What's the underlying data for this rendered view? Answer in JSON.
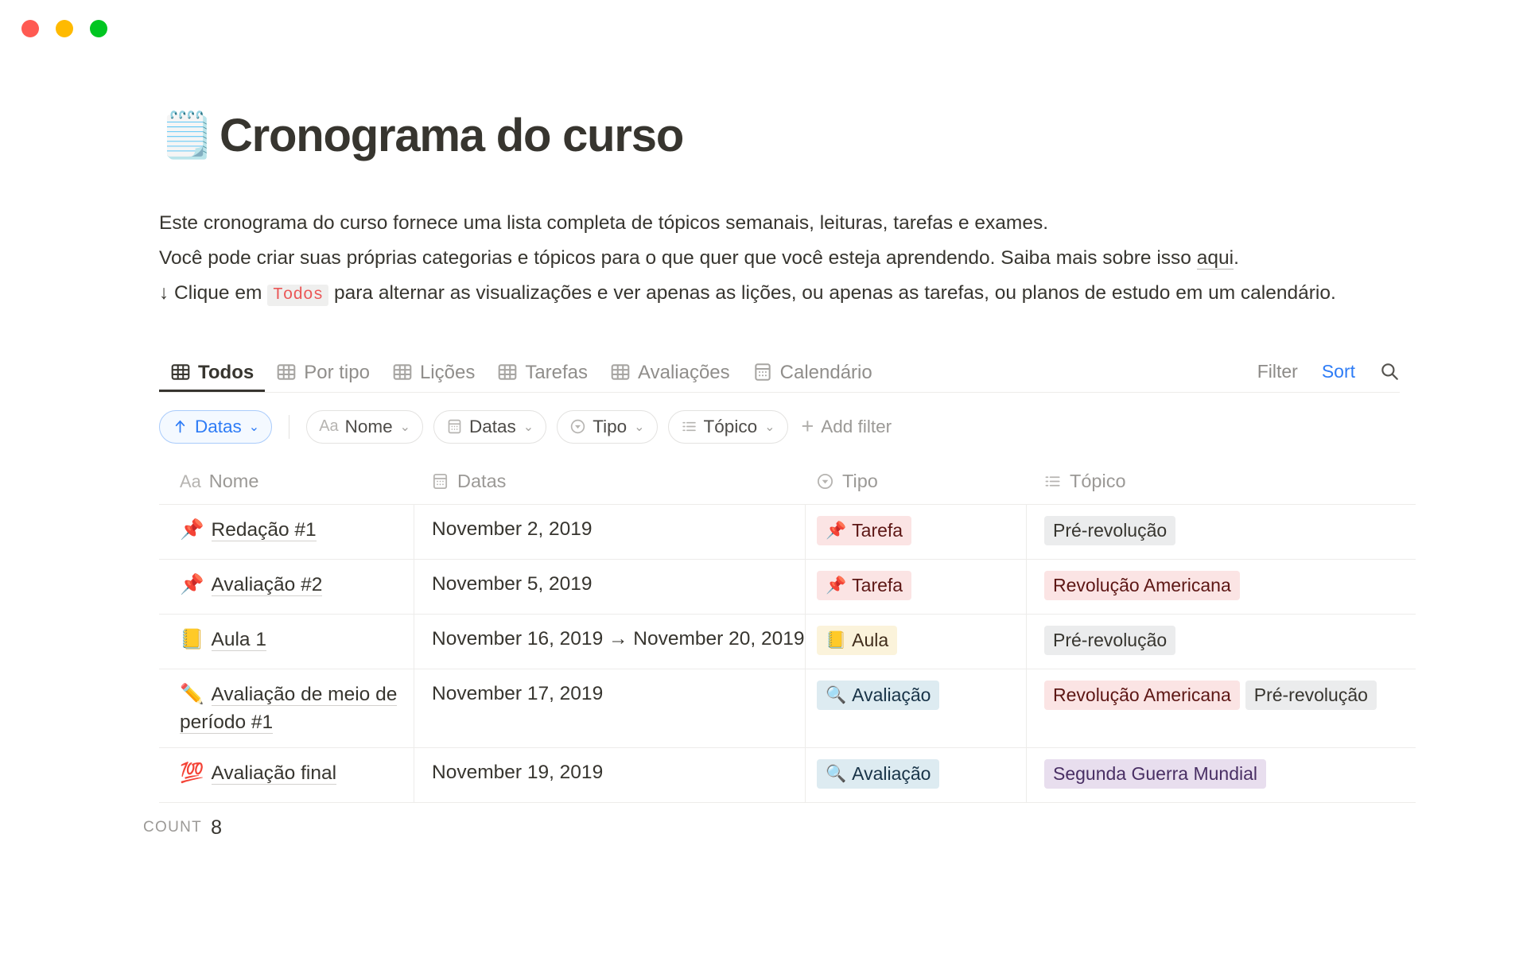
{
  "window": {
    "traffic_lights": [
      {
        "name": "close",
        "color": "#FF5A52"
      },
      {
        "name": "minimize",
        "color": "#FFBA00"
      },
      {
        "name": "maximize",
        "color": "#00C621"
      }
    ]
  },
  "page": {
    "emoji": "🗒️",
    "title": "Cronograma do curso",
    "description": {
      "line1": "Este cronograma do curso fornece uma lista completa de tópicos semanais, leituras, tarefas e exames.",
      "line2_a": "Você pode criar suas próprias categorias e tópicos para o que quer que você esteja aprendendo. Saiba mais sobre isso ",
      "line2_link": "aqui",
      "line2_b": ".",
      "line3_a": "↓ Clique em ",
      "line3_code": "Todos",
      "line3_b": " para alternar as visualizações e ver apenas as lições, ou apenas as tarefas, ou planos de estudo em um calendário."
    }
  },
  "tabs": [
    {
      "label": "Todos",
      "icon": "table-icon",
      "active": true
    },
    {
      "label": "Por tipo",
      "icon": "table-icon",
      "active": false
    },
    {
      "label": "Lições",
      "icon": "table-icon",
      "active": false
    },
    {
      "label": "Tarefas",
      "icon": "table-icon",
      "active": false
    },
    {
      "label": "Avaliações",
      "icon": "table-icon",
      "active": false
    },
    {
      "label": "Calendário",
      "icon": "calendar-icon",
      "active": false
    }
  ],
  "toolbar": {
    "filter_label": "Filter",
    "sort_label": "Sort",
    "search_icon": "search-icon",
    "sort_active_color": "#2E7CF6"
  },
  "chips": {
    "sort": {
      "label": "Datas",
      "icon": "arrow-up-icon",
      "caret": "⌄"
    },
    "filters": [
      {
        "label": "Nome",
        "icon": "aa-icon",
        "caret": "⌄"
      },
      {
        "label": "Datas",
        "icon": "calendar-icon",
        "caret": "⌄"
      },
      {
        "label": "Tipo",
        "icon": "select-icon",
        "caret": "⌄"
      },
      {
        "label": "Tópico",
        "icon": "multiselect-icon",
        "caret": "⌄"
      }
    ],
    "add_filter_label": "Add filter"
  },
  "table": {
    "columns": [
      {
        "label": "Nome",
        "icon": "aa-icon"
      },
      {
        "label": "Datas",
        "icon": "calendar-icon"
      },
      {
        "label": "Tipo",
        "icon": "select-icon"
      },
      {
        "label": "Tópico",
        "icon": "multiselect-icon"
      }
    ],
    "rows": [
      {
        "emoji": "📌",
        "name": "Redação #1",
        "dates": "November 2, 2019",
        "tipo": {
          "emoji": "📌",
          "label": "Tarefa",
          "bg": "#FBE4E4",
          "fg": "#5D1715"
        },
        "topics": [
          {
            "label": "Pré-revolução",
            "bg": "#EBECED",
            "fg": "#37352F"
          }
        ]
      },
      {
        "emoji": "📌",
        "name": "Avaliação #2",
        "dates": "November 5, 2019",
        "tipo": {
          "emoji": "📌",
          "label": "Tarefa",
          "bg": "#FBE4E4",
          "fg": "#5D1715"
        },
        "topics": [
          {
            "label": "Revolução Americana",
            "bg": "#FBE4E4",
            "fg": "#5D1715"
          }
        ]
      },
      {
        "emoji": "📒",
        "name": "Aula 1",
        "dates": "November 16, 2019 → November 20, 2019",
        "tipo": {
          "emoji": "📒",
          "label": "Aula",
          "bg": "#FBF3DB",
          "fg": "#402C1B"
        },
        "topics": [
          {
            "label": "Pré-revolução",
            "bg": "#EBECED",
            "fg": "#37352F"
          }
        ]
      },
      {
        "emoji": "✏️",
        "name": "Avaliação de meio de período #1",
        "dates": "November 17, 2019",
        "tipo": {
          "emoji": "🔍",
          "label": "Avaliação",
          "bg": "#DDEBF1",
          "fg": "#183347"
        },
        "topics": [
          {
            "label": "Revolução Americana",
            "bg": "#FBE4E4",
            "fg": "#5D1715"
          },
          {
            "label": "Pré-revolução",
            "bg": "#EBECED",
            "fg": "#37352F"
          }
        ]
      },
      {
        "emoji": "💯",
        "name": "Avaliação final",
        "dates": "November 19, 2019",
        "tipo": {
          "emoji": "🔍",
          "label": "Avaliação",
          "bg": "#DDEBF1",
          "fg": "#183347"
        },
        "topics": [
          {
            "label": "Segunda Guerra Mundial",
            "bg": "#E8DEEE",
            "fg": "#492F64"
          }
        ]
      }
    ],
    "footer": {
      "count_label": "COUNT",
      "count_value": "8"
    }
  }
}
